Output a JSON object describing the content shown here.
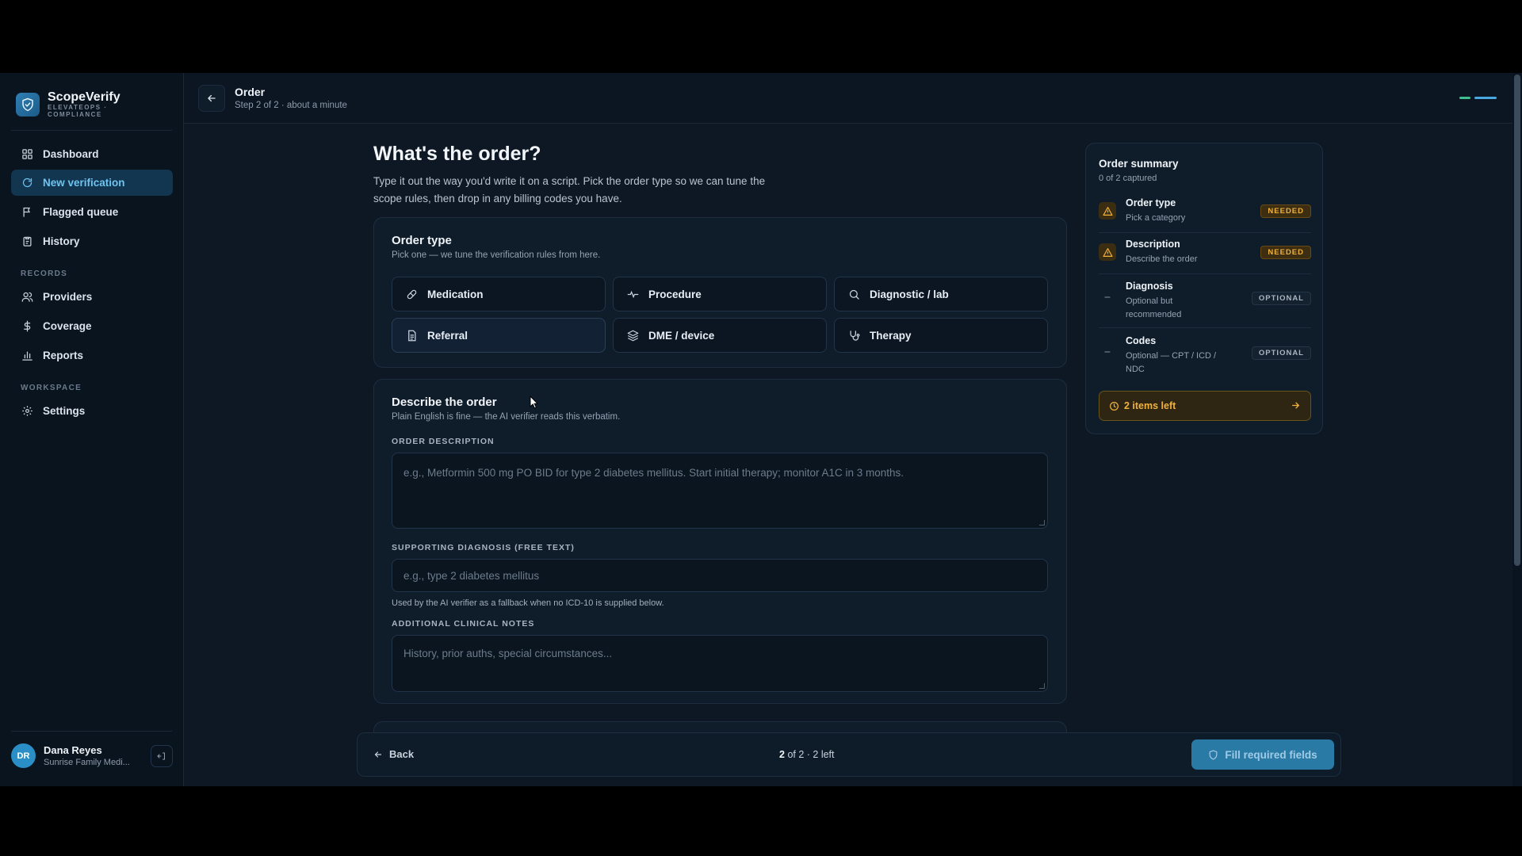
{
  "brand": {
    "name": "ScopeVerify",
    "subtitle_line1": "ELEVATEOPS ·",
    "subtitle_line2": "COMPLIANCE",
    "color": "#2f7fb4"
  },
  "sidebar": {
    "main_items": [
      {
        "label": "Dashboard",
        "icon": "grid-icon"
      },
      {
        "label": "New verification",
        "icon": "refresh-icon",
        "active": true
      },
      {
        "label": "Flagged queue",
        "icon": "flag-icon"
      },
      {
        "label": "History",
        "icon": "clipboard-icon"
      }
    ],
    "records_heading": "RECORDS",
    "records_items": [
      {
        "label": "Providers",
        "icon": "users-icon"
      },
      {
        "label": "Coverage",
        "icon": "dollar-icon"
      },
      {
        "label": "Reports",
        "icon": "bar-chart-icon"
      }
    ],
    "workspace_heading": "WORKSPACE",
    "workspace_items": [
      {
        "label": "Settings",
        "icon": "gear-icon"
      }
    ]
  },
  "user": {
    "initials": "DR",
    "name": "Dana Reyes",
    "org": "Sunrise Family Medi..."
  },
  "header": {
    "title": "Order",
    "subtitle": "Step 2 of 2 · about a minute"
  },
  "main": {
    "title": "What's the order?",
    "description": "Type it out the way you'd write it on a script. Pick the order type so we can tune the scope rules, then drop in any billing codes you have.",
    "order_type": {
      "title": "Order type",
      "subtitle": "Pick one — we tune the verification rules from here.",
      "options": [
        {
          "label": "Medication",
          "icon": "pill-icon"
        },
        {
          "label": "Procedure",
          "icon": "pulse-icon"
        },
        {
          "label": "Diagnostic / lab",
          "icon": "search-icon"
        },
        {
          "label": "Referral",
          "icon": "document-icon"
        },
        {
          "label": "DME / device",
          "icon": "layers-icon"
        },
        {
          "label": "Therapy",
          "icon": "stethoscope-icon"
        }
      ]
    },
    "describe": {
      "title": "Describe the order",
      "subtitle": "Plain English is fine — the AI verifier reads this verbatim.",
      "order_description_label": "ORDER DESCRIPTION",
      "order_description_placeholder": "e.g., Metformin 500 mg PO BID for type 2 diabetes mellitus. Start initial therapy; monitor A1C in 3 months.",
      "diagnosis_label": "SUPPORTING DIAGNOSIS (FREE TEXT)",
      "diagnosis_placeholder": "e.g., type 2 diabetes mellitus",
      "diagnosis_hint": "Used by the AI verifier as a fallback when no ICD-10 is supplied below.",
      "notes_label": "ADDITIONAL CLINICAL NOTES",
      "notes_placeholder": "History, prior auths, special circumstances..."
    }
  },
  "summary": {
    "title": "Order summary",
    "subtitle": "0 of 2 captured",
    "items": [
      {
        "title": "Order type",
        "sub": "Pick a category",
        "badge": "NEEDED",
        "icon": "warning-icon"
      },
      {
        "title": "Description",
        "sub": "Describe the order",
        "badge": "NEEDED",
        "icon": "warning-icon"
      },
      {
        "title": "Diagnosis",
        "sub": "Optional but recommended",
        "badge": "OPTIONAL",
        "icon": "dash-icon"
      },
      {
        "title": "Codes",
        "sub": "Optional — CPT / ICD / NDC",
        "badge": "OPTIONAL",
        "icon": "dash-icon"
      }
    ],
    "items_left": "2 items left"
  },
  "bottom_bar": {
    "back_label": "Back",
    "step_current": "2",
    "step_rest": "of 2 · 2 left",
    "fill_button": "Fill required fields"
  },
  "colors": {
    "accent": "#6ec4f0",
    "warning": "#f0b13d",
    "progress_done": "#3fbf8f",
    "progress_active": "#4aa8e0"
  }
}
